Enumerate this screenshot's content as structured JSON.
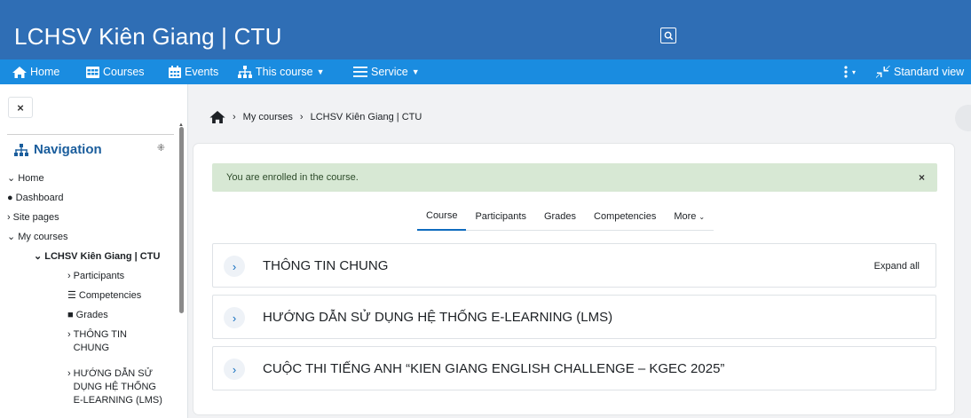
{
  "header": {
    "site_title": "LCHSV Kiên Giang | CTU",
    "search_icon": "search-icon"
  },
  "navbar": {
    "home": "Home",
    "courses": "Courses",
    "events": "Events",
    "this_course": "This course",
    "service": "Service",
    "standard_view": "Standard view"
  },
  "sidebar": {
    "close": "×",
    "title": "Navigation",
    "items": [
      "Home",
      "Dashboard",
      "Site pages",
      "My courses",
      "LCHSV Kiên Giang | CTU",
      "Participants",
      "Competencies",
      "Grades",
      "THÔNG TIN CHUNG",
      "HƯỚNG DẪN SỬ DỤNG HỆ THỐNG E-LEARNING (LMS)"
    ]
  },
  "breadcrumb": {
    "items": [
      "My courses",
      "LCHSV Kiên Giang | CTU"
    ]
  },
  "alert": {
    "text": "You are enrolled in the course.",
    "close": "×"
  },
  "tabs": [
    "Course",
    "Participants",
    "Grades",
    "Competencies",
    "More"
  ],
  "sections": [
    "THÔNG TIN CHUNG",
    "HƯỚNG DẪN SỬ DỤNG HỆ THỐNG E-LEARNING (LMS)",
    "CUỘC THI TIẾNG ANH “KIEN GIANG ENGLISH CHALLENGE – KGEC 2025”"
  ],
  "expand_all": "Expand all",
  "colors": {
    "header": "#2f6eb5",
    "navbar": "#1a8ce0",
    "alert": "#d7e8d4"
  }
}
